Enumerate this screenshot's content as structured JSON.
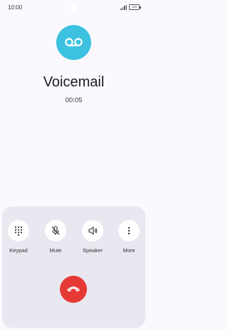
{
  "status_bar": {
    "time": "10:00",
    "battery": "100"
  },
  "call": {
    "contact_name": "Voicemail",
    "duration": "00:05",
    "avatar_icon": "voicemail-icon",
    "avatar_color": "#3cc2e0"
  },
  "controls": [
    {
      "label": "Keypad",
      "icon": "keypad-icon"
    },
    {
      "label": "Mute",
      "icon": "mic-off-icon"
    },
    {
      "label": "Speaker",
      "icon": "speaker-icon"
    },
    {
      "label": "More",
      "icon": "more-vertical-icon"
    }
  ],
  "end_call": {
    "icon": "end-call-icon",
    "color": "#e53935"
  }
}
